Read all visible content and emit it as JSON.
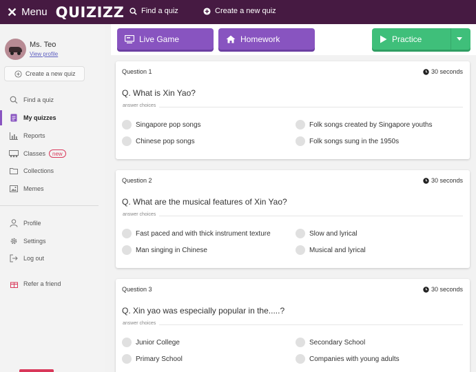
{
  "topbar": {
    "menu_label": "Menu",
    "logo": "QUIZIZZ",
    "find_quiz": "Find a quiz",
    "create_quiz": "Create a new quiz"
  },
  "sidebar": {
    "user_name": "Ms. Teo",
    "view_profile": "View profile",
    "create_button": "Create a new quiz",
    "nav": [
      {
        "label": "Find a quiz",
        "icon": "search-icon"
      },
      {
        "label": "My quizzes",
        "icon": "document-icon",
        "active": true
      },
      {
        "label": "Reports",
        "icon": "bar-chart-icon"
      },
      {
        "label": "Classes",
        "icon": "classroom-icon",
        "badge": "new"
      },
      {
        "label": "Collections",
        "icon": "folder-icon"
      },
      {
        "label": "Memes",
        "icon": "image-icon"
      }
    ],
    "nav2": [
      {
        "label": "Profile",
        "icon": "user-icon"
      },
      {
        "label": "Settings",
        "icon": "gear-icon"
      },
      {
        "label": "Log out",
        "icon": "logout-icon"
      }
    ],
    "refer": {
      "label": "Refer a friend",
      "icon": "gift-icon"
    }
  },
  "actions": {
    "live_game": "Live Game",
    "homework": "Homework",
    "practice": "Practice"
  },
  "answer_choices_label": "answer choices",
  "questions": [
    {
      "number": "Question 1",
      "time": "30 seconds",
      "text": "Q. What is Xin Yao?",
      "options": [
        "Singapore pop songs",
        "Folk songs created by Singapore youths",
        "Chinese pop songs",
        "Folk songs sung in the 1950s"
      ]
    },
    {
      "number": "Question 2",
      "time": "30 seconds",
      "text": "Q. What are the musical features of Xin Yao?",
      "options": [
        "Fast paced and with thick instrument texture",
        "Slow and lyrical",
        "Man singing in Chinese",
        "Musical and lyrical"
      ]
    },
    {
      "number": "Question 3",
      "time": "30 seconds",
      "text": "Q. Xin yao was especially popular in the.....?",
      "options": [
        "Junior College",
        "Secondary School",
        "Primary School",
        "Companies with young adults"
      ]
    }
  ],
  "colors": {
    "topbar": "#461a42",
    "purple_button": "#8854c0",
    "green_button": "#3fbf7a",
    "new_badge": "#d9385a"
  }
}
